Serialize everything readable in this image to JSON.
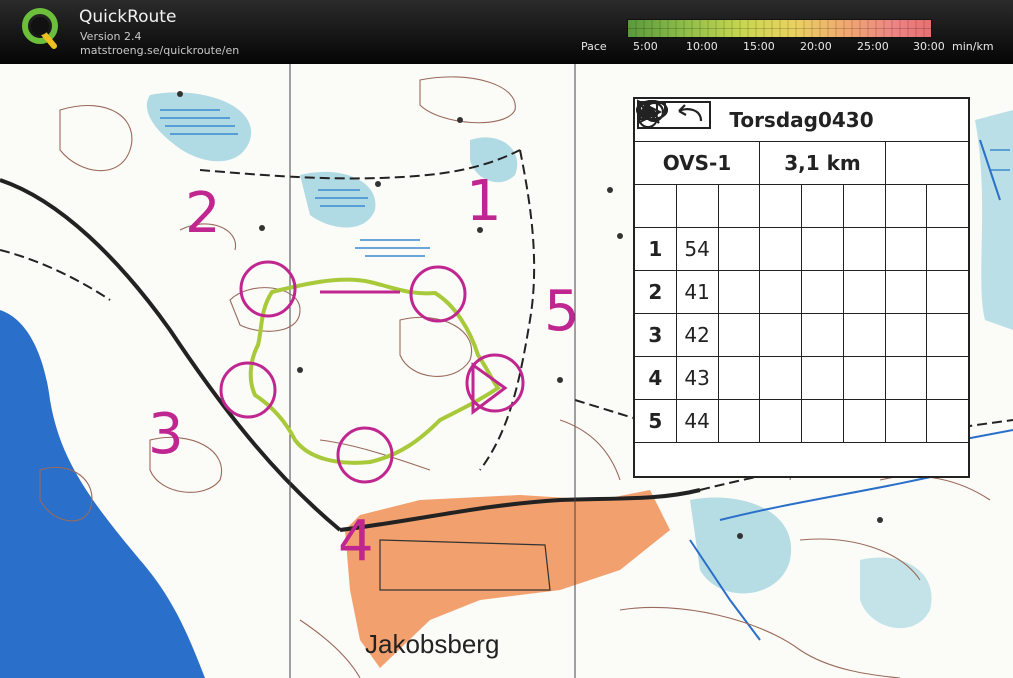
{
  "app": {
    "title": "QuickRoute",
    "version": "Version 2.4",
    "url": "matstroeng.se/quickroute/en"
  },
  "pace_scale": {
    "label": "Pace",
    "ticks": [
      "5:00",
      "10:00",
      "15:00",
      "20:00",
      "25:00",
      "30:00"
    ],
    "unit": "min/km",
    "colors": [
      "#5a9a3b",
      "#8cbc48",
      "#c9d750",
      "#ead260",
      "#f0a870",
      "#ee8484"
    ]
  },
  "map": {
    "control_numbers": [
      "1",
      "2",
      "3",
      "4",
      "5"
    ],
    "place_name": "Jakobsberg",
    "course_color": "#c0268f",
    "water_color": "#2a6fc9",
    "marsh_color": "#9fd3de",
    "settlement_color": "#f2a06e",
    "route_color": "#a8c93a"
  },
  "legend": {
    "event": "Torsdag0430",
    "course": "OVS-1",
    "length": "3,1 km",
    "start_icon": "start-triangle-icon",
    "start_feature_icon": "ellipse-icon",
    "controls": [
      {
        "number": "1",
        "code": "54",
        "direction": "",
        "feature": "triangle-icon",
        "location": "dot-top-circle-icon"
      },
      {
        "number": "2",
        "code": "41",
        "direction": "",
        "feature": "triangle-icon",
        "location": "dot-left-circle-icon"
      },
      {
        "number": "3",
        "code": "42",
        "direction": "arrow-nw-icon",
        "feature": "triangle-icon",
        "location": "dot-left-circle-icon"
      },
      {
        "number": "4",
        "code": "43",
        "direction": "arrow-nw-icon",
        "feature": "comb-icon",
        "location": "corner-icon"
      },
      {
        "number": "5",
        "code": "44",
        "direction": "",
        "feature": "ellipse-icon",
        "location": ""
      }
    ],
    "finish_icon": "return-arrow-icon"
  }
}
